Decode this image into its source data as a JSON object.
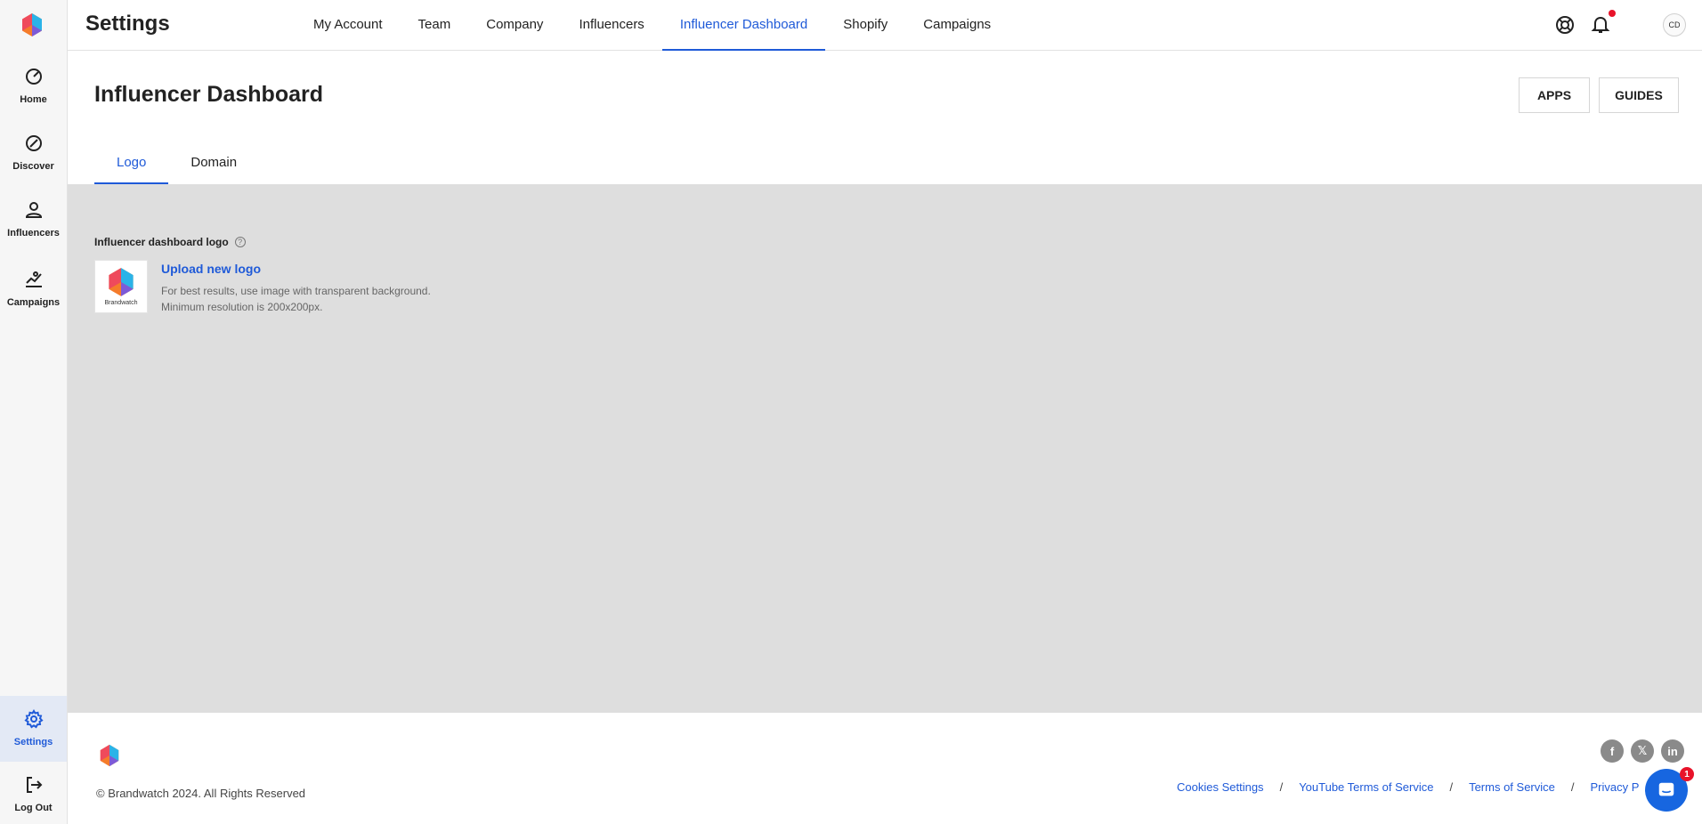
{
  "colors": {
    "accent": "#1f5ad8",
    "content_bg": "#dedede",
    "notification": "#e8132a",
    "chat": "#1766e0"
  },
  "sidebar": {
    "logo_icon": "brand-hexagon-icon",
    "items": [
      {
        "label": "Home",
        "icon": "gauge-icon"
      },
      {
        "label": "Discover",
        "icon": "compass-icon"
      },
      {
        "label": "Influencers",
        "icon": "person-icon"
      },
      {
        "label": "Campaigns",
        "icon": "chart-person-icon"
      },
      {
        "label": "Settings",
        "icon": "gear-icon",
        "active": true
      },
      {
        "label": "Log Out",
        "icon": "logout-icon"
      }
    ]
  },
  "header": {
    "title": "Settings",
    "tabs": [
      {
        "label": "My Account"
      },
      {
        "label": "Team"
      },
      {
        "label": "Company"
      },
      {
        "label": "Influencers"
      },
      {
        "label": "Influencer Dashboard",
        "active": true
      },
      {
        "label": "Shopify"
      },
      {
        "label": "Campaigns"
      }
    ],
    "avatar_initials": "CD"
  },
  "page": {
    "title": "Influencer Dashboard",
    "buttons": {
      "apps": "APPS",
      "guides": "GUIDES"
    },
    "subtabs": [
      {
        "label": "Logo",
        "active": true
      },
      {
        "label": "Domain"
      }
    ]
  },
  "logo_section": {
    "label": "Influencer dashboard logo",
    "help_glyph": "?",
    "thumb_text": "Brandwatch",
    "upload_link": "Upload new logo",
    "hint_line1": "For best results, use image with transparent background.",
    "hint_line2": "Minimum resolution is 200x200px."
  },
  "footer": {
    "copyright": "© Brandwatch 2024. All Rights Reserved",
    "links": [
      "Cookies Settings",
      "YouTube Terms of Service",
      "Terms of Service",
      "Privacy P"
    ],
    "separator": "/",
    "socials": [
      {
        "icon": "facebook-icon",
        "glyph": "f"
      },
      {
        "icon": "x-icon",
        "glyph": "𝕏"
      },
      {
        "icon": "linkedin-icon",
        "glyph": "in"
      }
    ]
  },
  "chat": {
    "badge": "1"
  }
}
